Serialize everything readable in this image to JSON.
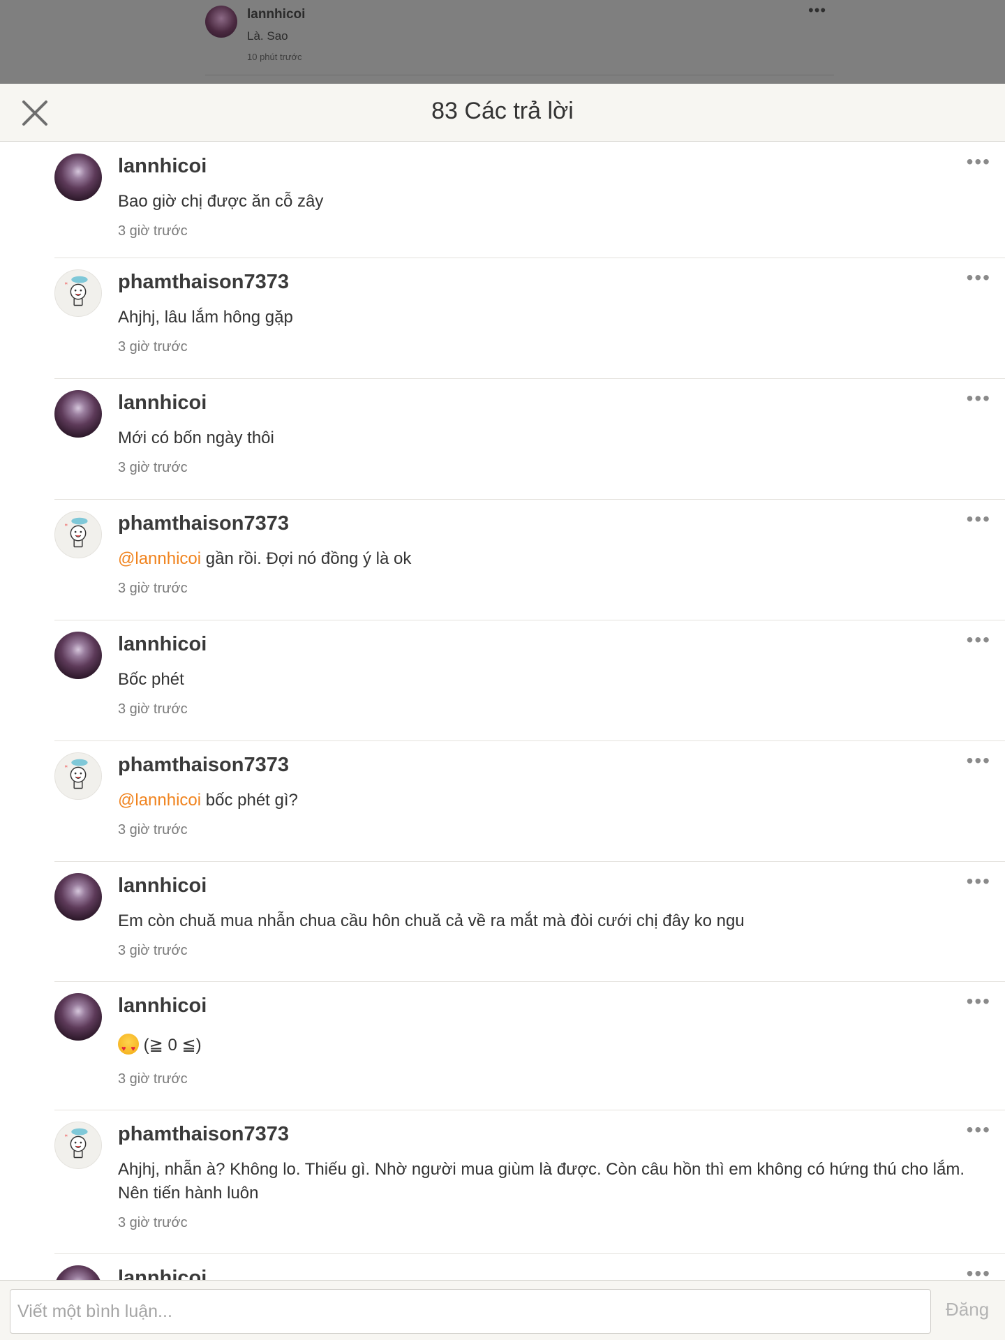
{
  "background_post": {
    "username": "lannhicoi",
    "text": "Là. Sao",
    "time": "10 phút trước",
    "more": "•••"
  },
  "header": {
    "title": "83 Các trả lời",
    "close_icon": "close-icon"
  },
  "more_label": "•••",
  "comments": [
    {
      "username": "lannhicoi",
      "avatar": "dark",
      "text": "Bao giờ chị được ăn cỗ zây",
      "time": "3 giờ trước"
    },
    {
      "username": "phamthaison7373",
      "avatar": "light",
      "text": "Ahjhj, lâu lắm hông gặp",
      "time": "3 giờ trước"
    },
    {
      "username": "lannhicoi",
      "avatar": "dark",
      "text": "Mới có bốn ngày thôi",
      "time": "3 giờ trước"
    },
    {
      "username": "phamthaison7373",
      "avatar": "light",
      "mention": "@lannhicoi",
      "text": " gần rồi. Đợi nó đồng ý là ok",
      "time": "3 giờ trước"
    },
    {
      "username": "lannhicoi",
      "avatar": "dark",
      "text": "Bốc phét",
      "time": "3 giờ trước"
    },
    {
      "username": "phamthaison7373",
      "avatar": "light",
      "mention": "@lannhicoi",
      "text": " bốc phét gì?",
      "time": "3 giờ trước"
    },
    {
      "username": "lannhicoi",
      "avatar": "dark",
      "text": "Em còn chuă mua nhẫn chua cầu hôn chuă cả về ra mắt mà đòi cưới chị đây ko ngu",
      "time": "3 giờ trước"
    },
    {
      "username": "lannhicoi",
      "avatar": "dark",
      "emoji": "heart-eyes-emoji",
      "text": "(≧ 0 ≦)",
      "time": "3 giờ trước"
    },
    {
      "username": "phamthaison7373",
      "avatar": "light",
      "text": "Ahjhj, nhẫn à? Không lo. Thiếu gì. Nhờ người mua giùm là được. Còn câu hồn thì em không có hứng thú cho lắm. Nên tiến hành luôn",
      "time": "3 giờ trước"
    },
    {
      "username": "lannhicoi",
      "avatar": "dark",
      "text": "",
      "time": ""
    }
  ],
  "composer": {
    "placeholder": "Viết một bình luận...",
    "post_label": "Đăng"
  }
}
